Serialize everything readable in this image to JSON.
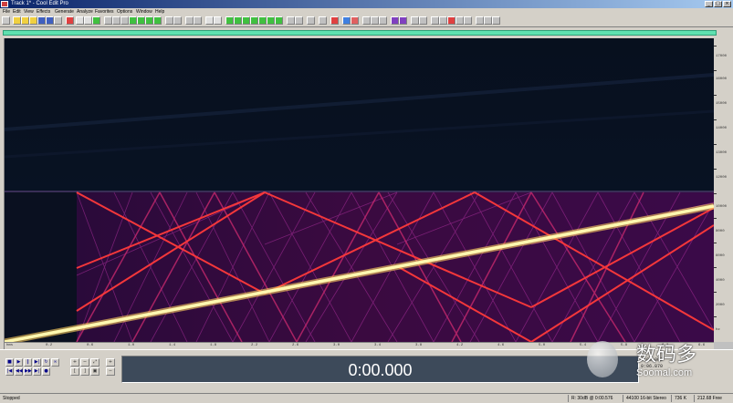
{
  "window": {
    "title": "Track 1* - Cool Edit Pro"
  },
  "menu": [
    "File",
    "Edit",
    "View",
    "Effects",
    "Generate",
    "Analyze",
    "Favorites",
    "Options",
    "Window",
    "Help"
  ],
  "transport": {
    "time": "0:00.000"
  },
  "selection": {
    "begin": "0:00.000",
    "end": "0:06.870"
  },
  "status": {
    "state": "Stopped",
    "level": "R: 30dB  @  0:00.576",
    "format": "44100  16-bit  Stereo",
    "size": "736 K",
    "free": "212.68 Free"
  },
  "watermark": {
    "cn": "数码多",
    "en": "Soomal.com"
  },
  "spectrogram": {
    "sweep_color": "#fff8b0",
    "image_color": "#e03030"
  }
}
